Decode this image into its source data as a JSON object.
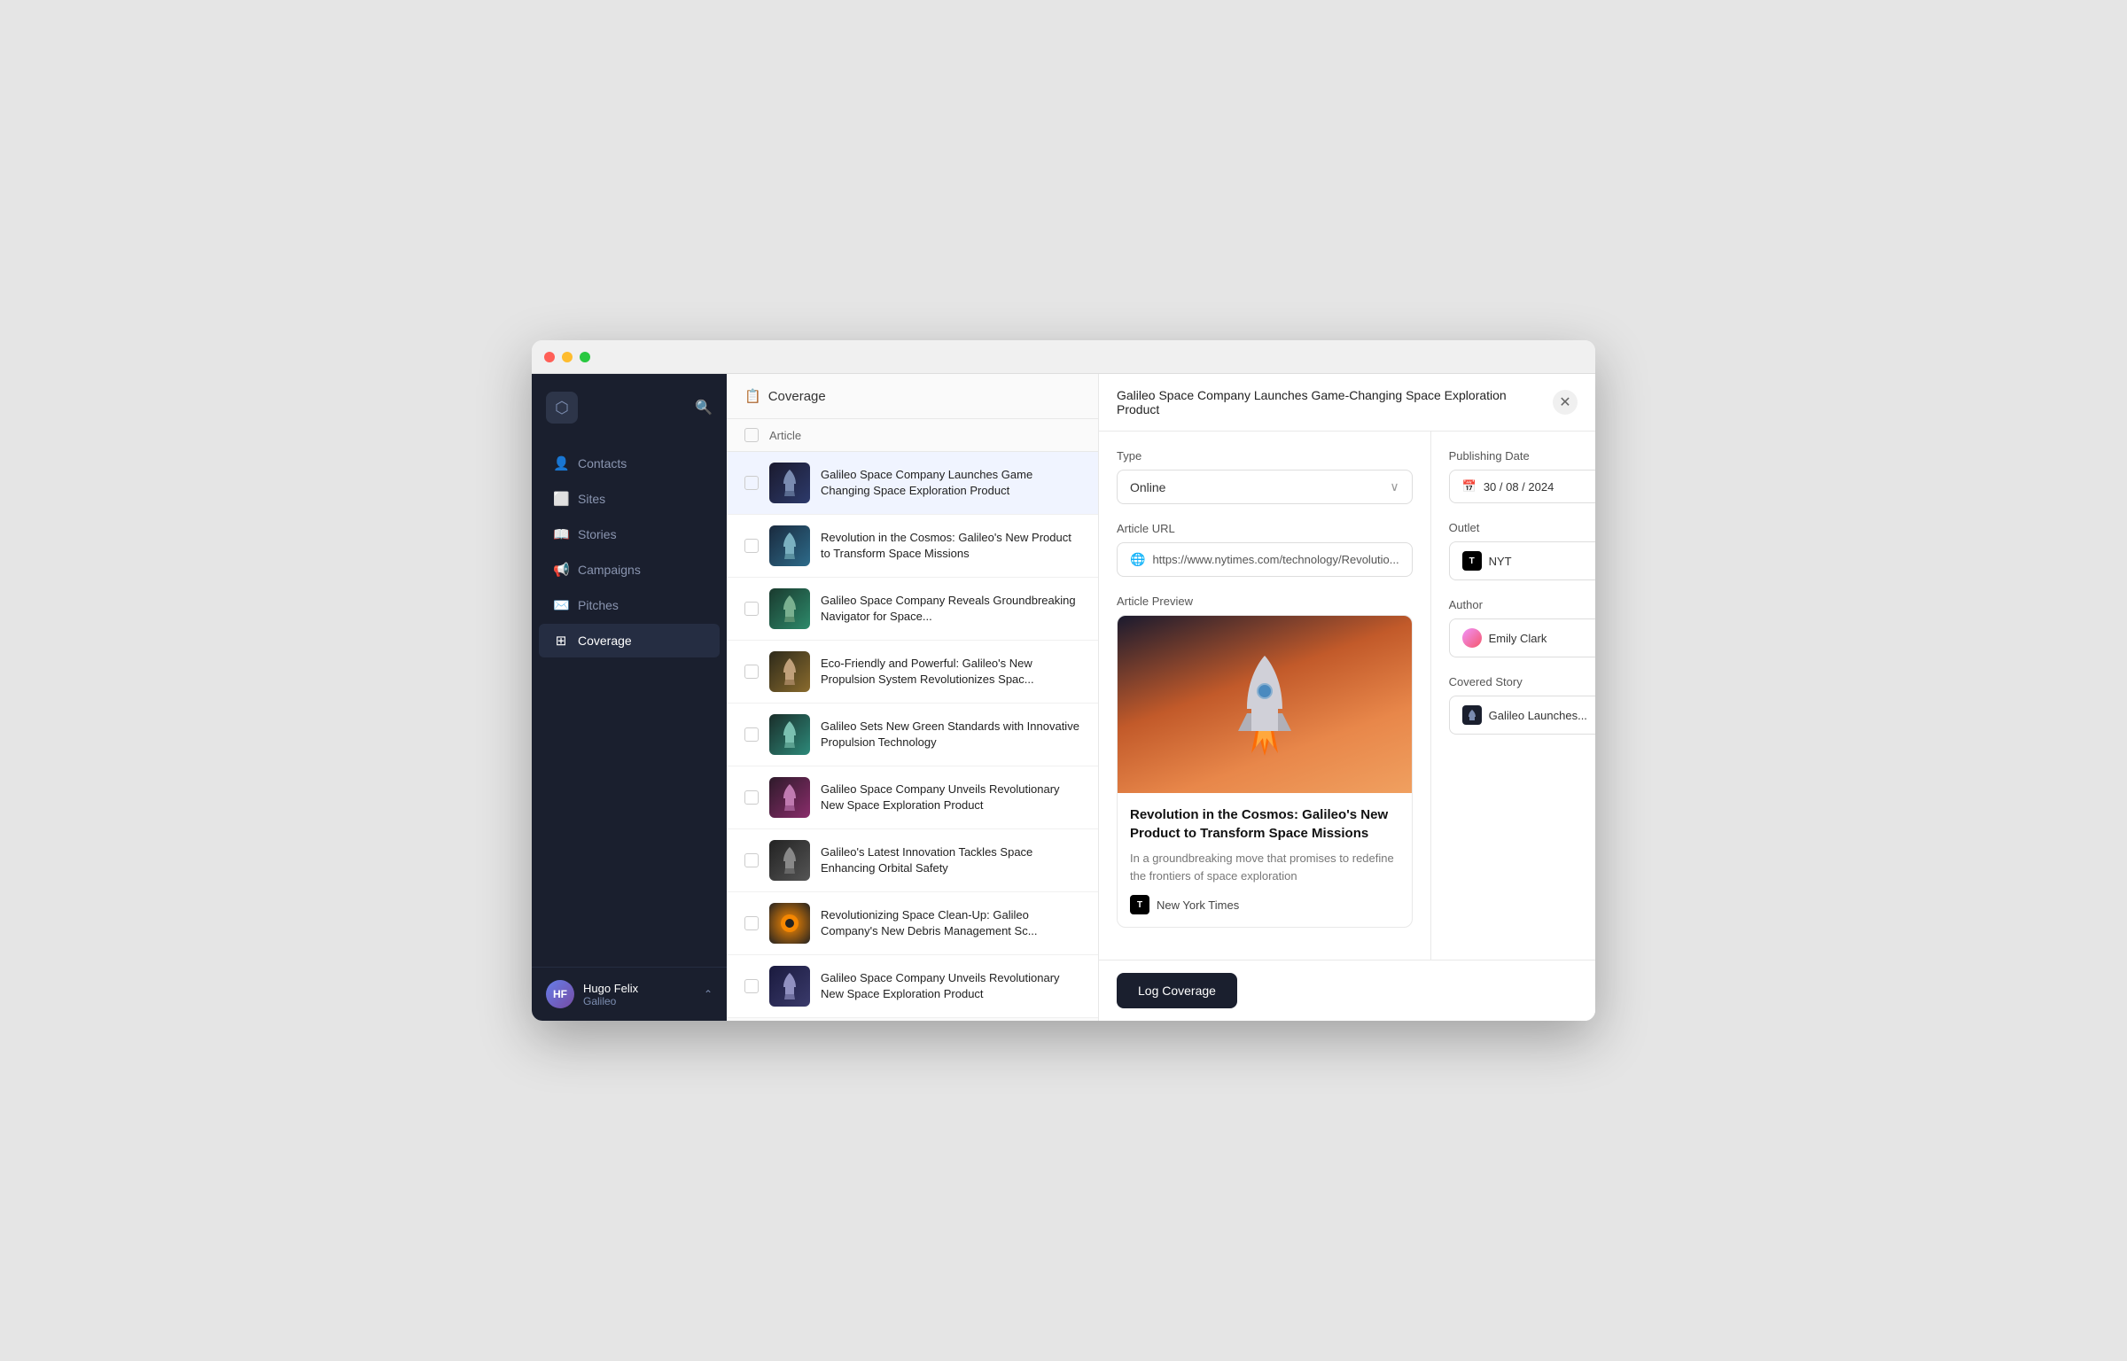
{
  "window": {
    "title": "Coverage"
  },
  "sidebar": {
    "logo_symbol": "⬡",
    "nav_items": [
      {
        "id": "contacts",
        "label": "Contacts",
        "icon": "👤",
        "active": false
      },
      {
        "id": "sites",
        "label": "Sites",
        "icon": "⬜",
        "active": false
      },
      {
        "id": "stories",
        "label": "Stories",
        "icon": "📖",
        "active": false
      },
      {
        "id": "campaigns",
        "label": "Campaigns",
        "icon": "📢",
        "active": false
      },
      {
        "id": "pitches",
        "label": "Pitches",
        "icon": "✉️",
        "active": false
      },
      {
        "id": "coverage",
        "label": "Coverage",
        "icon": "⊞",
        "active": true
      }
    ],
    "user": {
      "name": "Hugo Felix",
      "company": "Galileo",
      "initials": "HF"
    }
  },
  "coverage_panel": {
    "header": {
      "icon": "📋",
      "title": "Coverage"
    },
    "table_header": {
      "col_label": "Article"
    },
    "articles": [
      {
        "id": 1,
        "title": "Galileo Space Company Launches Game Changing Space Exploration Product",
        "thumb_class": "thumb-1",
        "selected": true
      },
      {
        "id": 2,
        "title": "Revolution in the Cosmos: Galileo's New Product to Transform Space Missions",
        "thumb_class": "thumb-2",
        "selected": false
      },
      {
        "id": 3,
        "title": "Galileo Space Company Reveals Groundbreaking Navigator for Space...",
        "thumb_class": "thumb-3",
        "selected": false
      },
      {
        "id": 4,
        "title": "Eco-Friendly and Powerful: Galileo's New Propulsion System Revolutionizes Spac...",
        "thumb_class": "thumb-4",
        "selected": false
      },
      {
        "id": 5,
        "title": "Galileo Sets New Green Standards with Innovative Propulsion Technology",
        "thumb_class": "thumb-5",
        "selected": false
      },
      {
        "id": 6,
        "title": "Galileo Space Company Unveils Revolutionary New Space Exploration Product",
        "thumb_class": "thumb-6",
        "selected": false
      },
      {
        "id": 7,
        "title": "Galileo's Latest Innovation Tackles Space Enhancing Orbital Safety",
        "thumb_class": "thumb-7",
        "selected": false
      },
      {
        "id": 8,
        "title": "Revolutionizing Space Clean-Up: Galileo Company's New Debris Management Sc...",
        "thumb_class": "thumb-8",
        "selected": false
      },
      {
        "id": 9,
        "title": "Galileo Space Company Unveils Revolutionary New Space Exploration Product",
        "thumb_class": "thumb-9",
        "selected": false
      }
    ]
  },
  "detail": {
    "title": "Galileo Space Company Launches Game-Changing Space Exploration Product",
    "type_label": "Type",
    "type_value": "Online",
    "url_label": "Article URL",
    "url_value": "https://www.nytimes.com/technology/Revolutio...",
    "preview_label": "Article Preview",
    "preview": {
      "article_title": "Revolution in the Cosmos: Galileo's New Product to Transform Space Missions",
      "excerpt": "In a groundbreaking move that promises to redefine the frontiers of space exploration",
      "outlet_name": "New York Times",
      "outlet_symbol": "T"
    },
    "right": {
      "publishing_date_label": "Publishing Date",
      "publishing_date": "30 / 08 / 2024",
      "outlet_label": "Outlet",
      "outlet_name": "NYT",
      "outlet_symbol": "T",
      "author_label": "Author",
      "author_name": "Emily Clark",
      "covered_story_label": "Covered Story",
      "covered_story_name": "Galileo Launches..."
    },
    "log_button_label": "Log Coverage"
  }
}
